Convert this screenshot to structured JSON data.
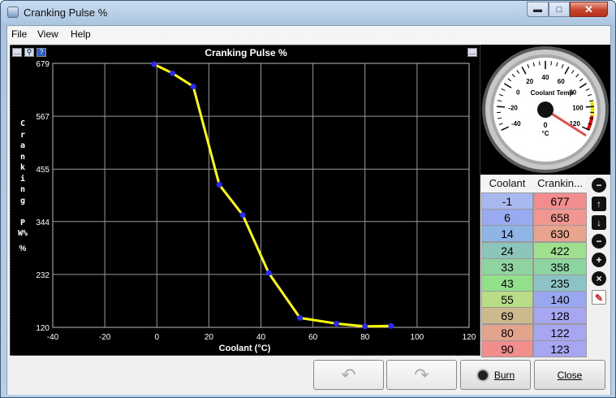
{
  "window": {
    "title": "Cranking Pulse %"
  },
  "menu": {
    "file": "File",
    "view": "View",
    "help": "Help"
  },
  "chart_icons": {
    "left1": "...",
    "left2": "?",
    "right": "..."
  },
  "chart_data": {
    "type": "line",
    "title": "Cranking Pulse %",
    "xlabel": "Coolant (°C)",
    "ylabel": "Cranking PW%",
    "ylabel_unit": "%",
    "xlim": [
      -40,
      120
    ],
    "ylim": [
      120,
      679
    ],
    "x_ticks": [
      "-40",
      "-20",
      "0",
      "20",
      "40",
      "60",
      "80",
      "100",
      "120"
    ],
    "y_ticks": [
      "679",
      "567",
      "455",
      "344",
      "232",
      "120"
    ],
    "x": [
      -1,
      6,
      14,
      24,
      33,
      43,
      55,
      69,
      80,
      90
    ],
    "y": [
      677,
      658,
      630,
      422,
      358,
      235,
      140,
      128,
      122,
      123
    ],
    "line_color": "#ffff00",
    "point_color": "#2a2aff"
  },
  "gauge": {
    "title": "Coolant Temp",
    "value": "0",
    "unit": "°C",
    "ticks": [
      "-40",
      "-20",
      "0",
      "20",
      "40",
      "60",
      "80",
      "100",
      "120"
    ],
    "min": -40,
    "max": 120
  },
  "table": {
    "col1": "Coolant",
    "col2": "Crankin...",
    "rows": [
      {
        "c": "-1",
        "p": "677"
      },
      {
        "c": "6",
        "p": "658"
      },
      {
        "c": "14",
        "p": "630"
      },
      {
        "c": "24",
        "p": "422"
      },
      {
        "c": "33",
        "p": "358"
      },
      {
        "c": "43",
        "p": "235"
      },
      {
        "c": "55",
        "p": "140"
      },
      {
        "c": "69",
        "p": "128"
      },
      {
        "c": "80",
        "p": "122"
      },
      {
        "c": "90",
        "p": "123"
      }
    ]
  },
  "buttons": {
    "burn": "Burn",
    "close": "Close"
  }
}
